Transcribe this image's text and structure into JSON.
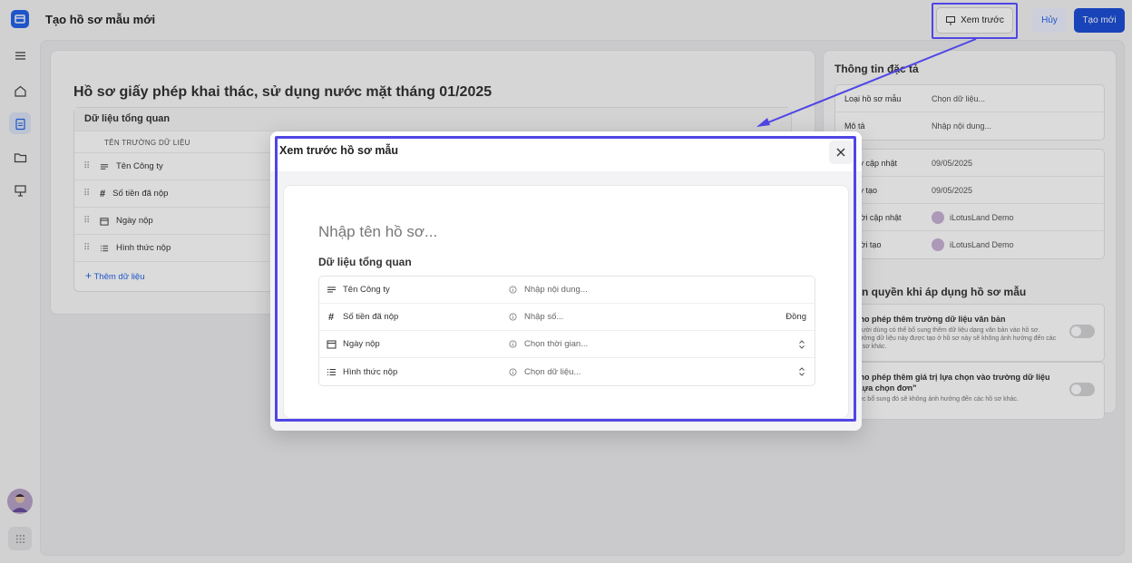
{
  "app": {
    "title": "Tạo hồ sơ mẫu mới",
    "preview_button": "Xem trước",
    "cancel_button": "Hủy",
    "create_button": "Tạo mới"
  },
  "document": {
    "title": "Hồ sơ giấy phép khai thác, sử dụng nước mặt tháng 01/2025",
    "section_title": "Dữ liệu tổng quan",
    "column_header": "TÊN TRƯỜNG DỮ LIỆU",
    "fields": [
      {
        "label": "Tên Công ty",
        "icon": "text-icon"
      },
      {
        "label": "Số tiền đã nộp",
        "icon": "hash-icon"
      },
      {
        "label": "Ngày nộp",
        "icon": "calendar-icon"
      },
      {
        "label": "Hình thức nộp",
        "icon": "list-icon"
      }
    ],
    "add_field": "Thêm dữ liệu"
  },
  "details": {
    "title": "Thông tin đặc tả",
    "type_label": "Loại hồ sơ mẫu",
    "type_placeholder": "Chọn dữ liệu...",
    "desc_label": "Mô tả",
    "desc_placeholder": "Nhập nội dung...",
    "updated_label": "Ngày cập nhật",
    "updated_value": "09/05/2025",
    "created_label": "Ngày tạo",
    "created_value": "09/05/2025",
    "updater_label": "Người cập nhật",
    "updater_value": "iLotusLand Demo",
    "creator_label": "Người tạo",
    "creator_value": "iLotusLand Demo"
  },
  "permissions": {
    "title": "Phân quyền khi áp dụng hồ sơ mẫu",
    "items": [
      {
        "name": "Cho phép thêm trường dữ liệu văn bản",
        "desc": "Người dùng có thể bổ sung thêm dữ liệu dạng văn bản vào hồ sơ. Trường dữ liệu này được tạo ở hồ sơ này sẽ không ảnh hưởng đến các hồ sơ khác."
      },
      {
        "name": "Cho phép thêm giá trị lựa chọn vào trường dữ liệu \"Lựa chọn đơn\"",
        "desc": "Việc bổ sung đó sẽ không ảnh hưởng đến các hồ sơ khác."
      }
    ]
  },
  "modal": {
    "title": "Xem trước hồ sơ mẫu",
    "name_placeholder": "Nhập tên hồ sơ...",
    "section_title": "Dữ liệu tổng quan",
    "rows": [
      {
        "label": "Tên Công ty",
        "placeholder": "Nhập nội dung...",
        "suffix": ""
      },
      {
        "label": "Số tiền đã nộp",
        "placeholder": "Nhập số...",
        "suffix": "Đồng"
      },
      {
        "label": "Ngày nộp",
        "placeholder": "Chọn thời gian...",
        "suffix": ""
      },
      {
        "label": "Hình thức nộp",
        "placeholder": "Chọn dữ liệu...",
        "suffix": ""
      }
    ]
  },
  "colors": {
    "accent": "#1d4ed8",
    "highlight": "#4f46e5"
  }
}
